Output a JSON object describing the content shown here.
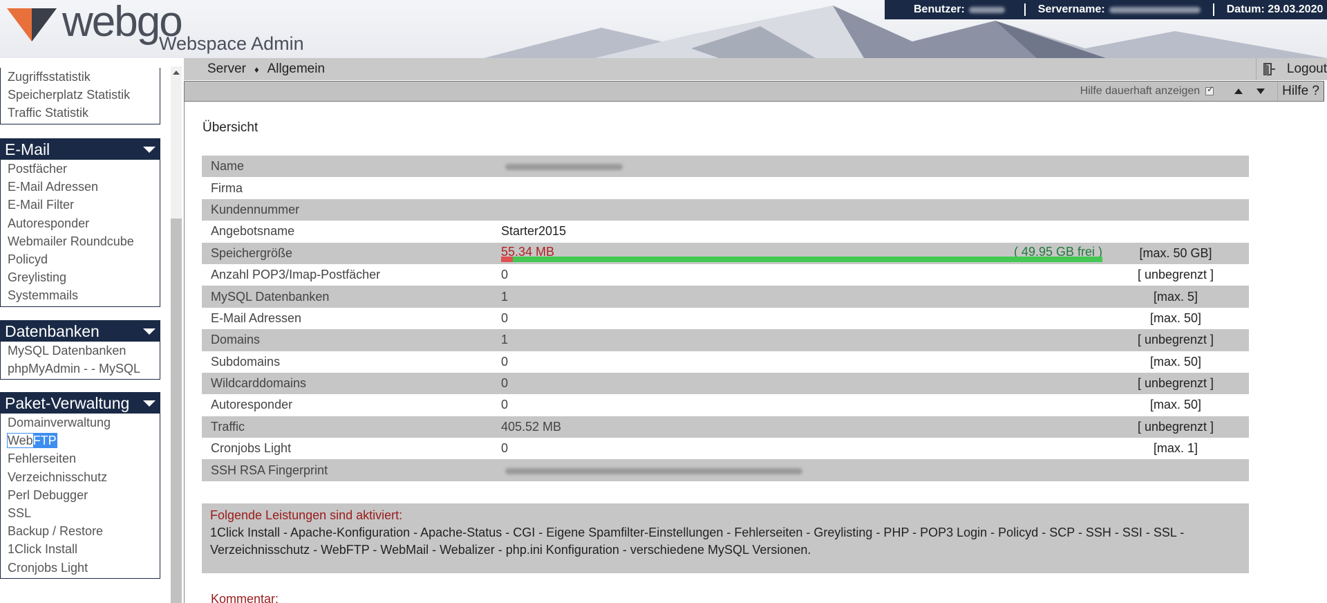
{
  "header": {
    "logo_name": "webgo",
    "logo_subtitle": "Webspace Admin",
    "user_label": "Benutzer:",
    "server_label": "Servername:",
    "date_label": "Datum: 29.03.2020"
  },
  "colors": {
    "navy": "#1a2a46",
    "accent_orange": "#e8703a",
    "used": "#e05050",
    "free": "#43c853"
  },
  "sidebar": {
    "statistik_items": [
      "Zugriffsstatistik",
      "Speicherplatz Statistik",
      "Traffic Statistik"
    ],
    "email": {
      "title": "E-Mail",
      "items": [
        "Postfächer",
        "E-Mail Adressen",
        "E-Mail Filter",
        "Autoresponder",
        "Webmailer Roundcube",
        "Policyd",
        "Greylisting",
        "Systemmails"
      ]
    },
    "datenbanken": {
      "title": "Datenbanken",
      "items": [
        "MySQL Datenbanken",
        "phpMyAdmin - - MySQL"
      ]
    },
    "paket": {
      "title": "Paket-Verwaltung",
      "items": [
        "Domainverwaltung",
        "WebFTP",
        "Fehlerseiten",
        "Verzeichnisschutz",
        "Perl Debugger",
        "SSL",
        "Backup / Restore",
        "1Click Install",
        "Cronjobs Light"
      ],
      "selected_part1": "Web",
      "selected_part2": "FTP"
    }
  },
  "nav": {
    "crumb1": "Server",
    "separator": "♦",
    "crumb2": "Allgemein",
    "logout": "Logout"
  },
  "help": {
    "label": "Hilfe dauerhaft anzeigen",
    "button": "Hilfe ?"
  },
  "main": {
    "title": "Übersicht",
    "rows": [
      {
        "label": "Name",
        "value": "",
        "limit": ""
      },
      {
        "label": "Firma",
        "value": "",
        "limit": ""
      },
      {
        "label": "Kundennummer",
        "value": "",
        "limit": ""
      },
      {
        "label": "Angebotsname",
        "value": "Starter2015",
        "limit": ""
      },
      {
        "label": "Speichergröße",
        "value": "",
        "limit": "[max. 50 GB]"
      },
      {
        "label": "Anzahl POP3/Imap-Postfächer",
        "value": "0",
        "limit": "[ unbegrenzt ]"
      },
      {
        "label": "MySQL Datenbanken",
        "value": "1",
        "limit": "[max. 5]"
      },
      {
        "label": "E-Mail Adressen",
        "value": "0",
        "limit": "[max. 50]"
      },
      {
        "label": "Domains",
        "value": "1",
        "limit": "[ unbegrenzt ]"
      },
      {
        "label": "Subdomains",
        "value": "0",
        "limit": "[max. 50]"
      },
      {
        "label": "Wildcarddomains",
        "value": "0",
        "limit": "[ unbegrenzt ]"
      },
      {
        "label": "Autoresponder",
        "value": "0",
        "limit": "[max. 50]"
      },
      {
        "label": "Traffic",
        "value": "405.52 MB",
        "limit": "[ unbegrenzt ]"
      },
      {
        "label": "Cronjobs Light",
        "value": "0",
        "limit": "[max. 1]"
      },
      {
        "label": "SSH RSA Fingerprint",
        "value": "",
        "limit": ""
      }
    ],
    "storage": {
      "used": "55.34 MB",
      "free": "( 49.95 GB frei )",
      "used_fraction": 0.02
    },
    "features_head": "Folgende Leistungen sind aktiviert:",
    "features_text": "1Click Install - Apache-Konfiguration - Apache-Status - CGI - Eigene Spamfilter-Einstellungen - Fehlerseiten - Greylisting - PHP - POP3 Login - Policyd - SCP - SSH - SSI - SSL - Verzeichnisschutz - WebFTP - WebMail - Webalizer - php.ini Konfiguration - verschiedene MySQL Versionen.",
    "kommentar": "Kommentar:"
  }
}
